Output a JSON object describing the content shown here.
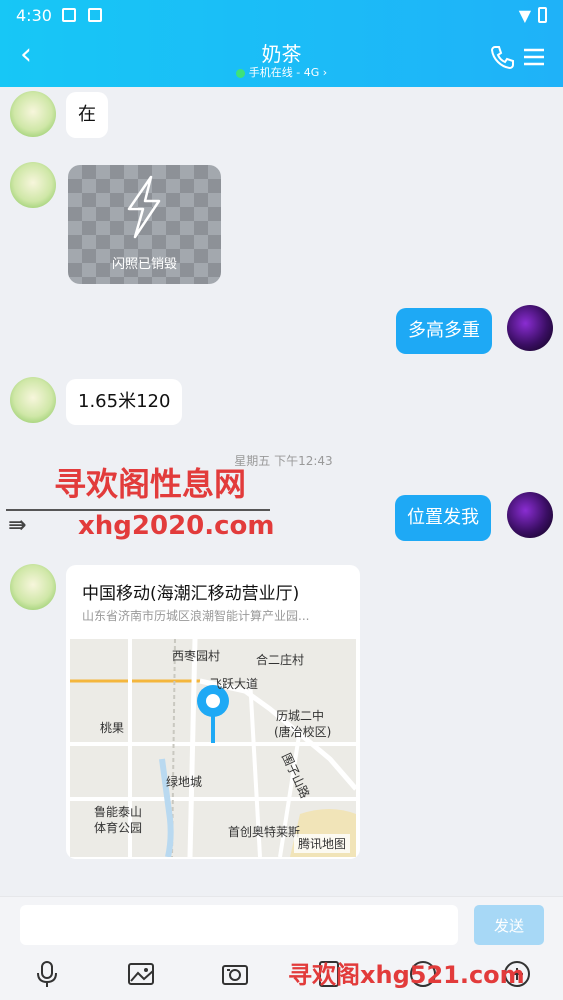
{
  "status_bar": {
    "time": "4:30"
  },
  "header": {
    "title": "奶茶",
    "subtitle": "手机在线 - 4G ›"
  },
  "messages": {
    "m1": "在",
    "m2_flash_label": "闪照已销毁",
    "m3": "多高多重",
    "m4": "1.65米120",
    "timestamp": "星期五 下午12:43",
    "m5": "位置发我"
  },
  "location": {
    "title": "中国移动(海潮汇移动营业厅)",
    "address": "山东省济南市历城区浪潮智能计算产业园...",
    "map_labels": {
      "l1": "西枣园村",
      "l2": "合二庄村",
      "l3": "飞跃大道",
      "l4": "历城二中",
      "l5": "(唐冶校区)",
      "l6": "桃果",
      "l7": "绿地城",
      "l8": "鲁能泰山",
      "l9": "体育公园",
      "l10": "首创奥特莱斯",
      "l11": "围子山路"
    },
    "brand": "腾讯地图"
  },
  "watermarks": {
    "w1": "寻欢阁性息网",
    "w2": "xhg2020.com",
    "w3": "寻欢阁xhg521.com"
  },
  "input": {
    "placeholder": "",
    "send_label": "发送"
  },
  "colors": {
    "header": "#1fb2f8",
    "bubble_out": "#1ea9f5",
    "send_disabled": "#a7d8f6"
  }
}
